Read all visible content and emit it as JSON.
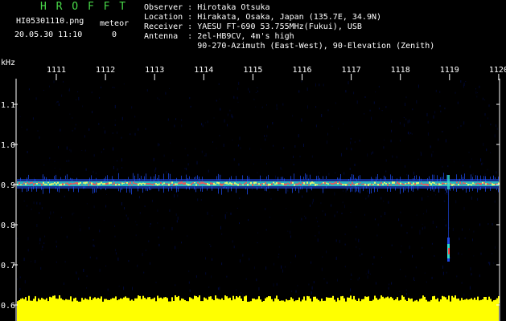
{
  "header": {
    "app_title": "H R O F F T",
    "filename": "HI05301110.png",
    "meteor_label": "meteor",
    "datetime": "20.05.30 11:10",
    "meteor_count": "0"
  },
  "station": {
    "observer": "Observer : Hirotaka Otsuka",
    "location": "Location : Hirakata, Osaka, Japan (135.7E, 34.9N)",
    "receiver": "Receiver : YAESU FT-690 53.755MHz(Fukui), USB",
    "antenna": "Antenna  : 2el-HB9CV, 4m's high",
    "antenna_direction": "           90-270-Azimuth (East-West), 90-Elevation (Zenith)"
  },
  "axes": {
    "y_unit": "kHz",
    "x_ticks": [
      "1111",
      "1112",
      "1113",
      "1114",
      "1115",
      "1116",
      "1117",
      "1118",
      "1119",
      "1120"
    ],
    "y_ticks": [
      "1.1",
      "1.0",
      "0.9",
      "0.8",
      "0.7",
      "0.6"
    ]
  },
  "colors": {
    "background": "#000000",
    "spectrogram_noise": "#000a40",
    "carrier_outer": "#2050ff",
    "carrier_mid": "#30e0d0",
    "carrier_core": "#ff5050",
    "noise_bar": "#ffff00",
    "title_green": "#48d848"
  }
}
